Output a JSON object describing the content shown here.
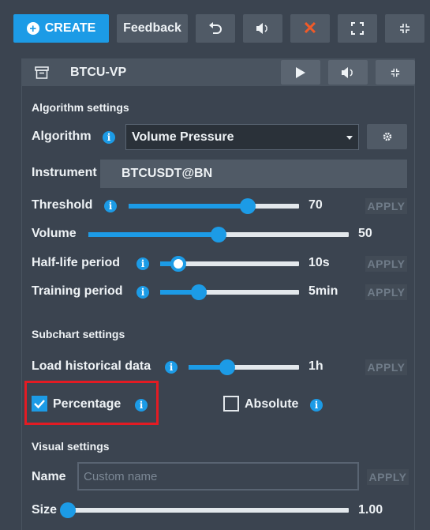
{
  "toolbar": {
    "create_label": "CREATE",
    "feedback_label": "Feedback"
  },
  "panel": {
    "title": "BTCU-VP",
    "algorithm_section": {
      "title": "Algorithm settings",
      "algorithm_label": "Algorithm",
      "algorithm_value": "Volume Pressure",
      "instrument_label": "Instrument",
      "instrument_value": "BTCUSDT@BN",
      "threshold": {
        "label": "Threshold",
        "value": "70",
        "level": 0.7,
        "apply": "APPLY"
      },
      "volume": {
        "label": "Volume",
        "value": "50",
        "level": 0.5
      },
      "half_life": {
        "label": "Half-life period",
        "value": "10s",
        "level": 0.13,
        "apply": "APPLY"
      },
      "training": {
        "label": "Training period",
        "value": "5min",
        "level": 0.28,
        "apply": "APPLY"
      }
    },
    "subchart_section": {
      "title": "Subchart settings",
      "load_history": {
        "label": "Load historical data",
        "value": "1h",
        "level": 0.35,
        "apply": "APPLY"
      },
      "percentage": {
        "label": "Percentage",
        "checked": true
      },
      "absolute": {
        "label": "Absolute",
        "checked": false
      }
    },
    "visual_section": {
      "title": "Visual settings",
      "name_label": "Name",
      "name_placeholder": "Custom name",
      "name_apply": "APPLY",
      "size": {
        "label": "Size",
        "value": "1.00",
        "level": 0.0
      }
    }
  },
  "colors": {
    "accent": "#1c9be6",
    "background": "#3b4450",
    "highlight_border": "#e31b23",
    "close_icon": "#f05a28"
  },
  "icons": [
    "plus-icon",
    "undo-icon",
    "mute-icon",
    "close-icon",
    "expand-icon",
    "collapse-icon",
    "archive-icon",
    "play-icon",
    "gear-icon",
    "info-icon",
    "check-icon"
  ]
}
